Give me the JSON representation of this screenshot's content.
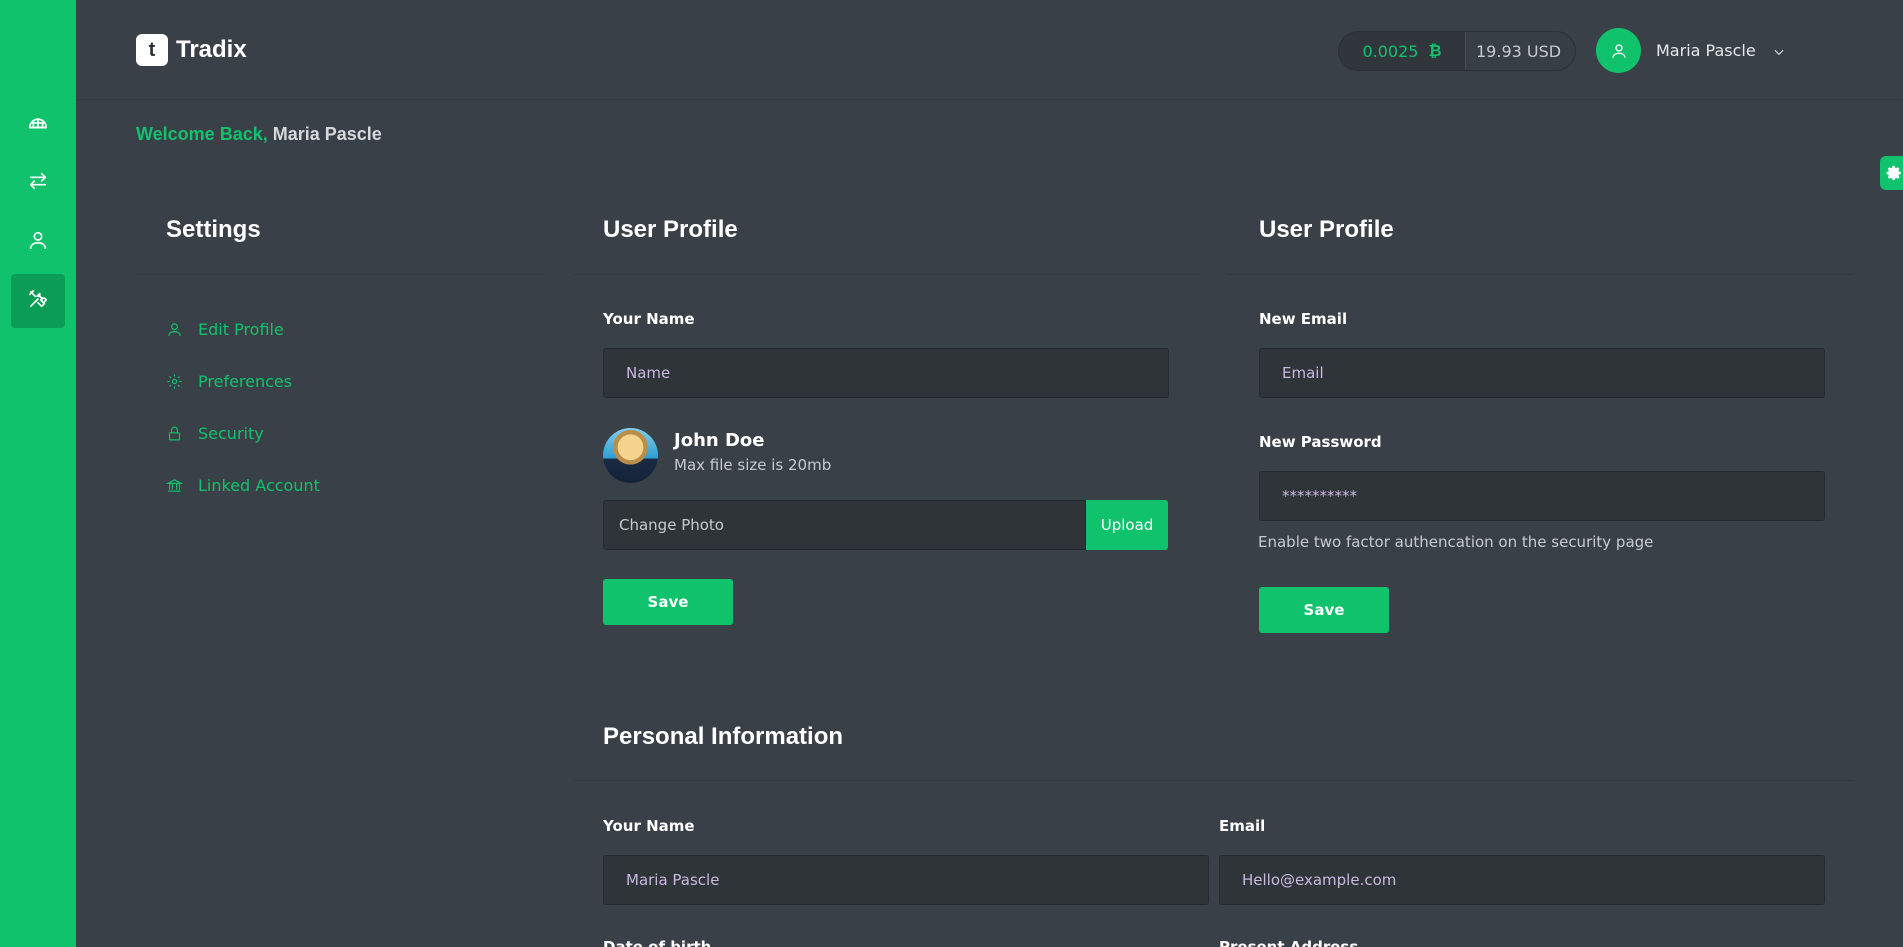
{
  "brand": {
    "name": "Tradix",
    "mark": "t"
  },
  "rail": {
    "items": [
      {
        "icon": "dashboard-icon",
        "active": false
      },
      {
        "icon": "exchange-icon",
        "active": false
      },
      {
        "icon": "user-icon",
        "active": false
      },
      {
        "icon": "tools-icon",
        "active": true
      }
    ]
  },
  "header": {
    "btc_balance": "0.0025",
    "btc_symbol": "₿",
    "usd_balance": "19.93 USD",
    "user_name": "Maria Pascle"
  },
  "welcome": {
    "prefix": "Welcome Back,",
    "name": "Maria Pascle"
  },
  "settings": {
    "title": "Settings",
    "menu": [
      {
        "label": "Edit Profile",
        "icon": "user-icon"
      },
      {
        "label": "Preferences",
        "icon": "gear-icon"
      },
      {
        "label": "Security",
        "icon": "lock-icon"
      },
      {
        "label": "Linked Account",
        "icon": "bank-icon"
      }
    ]
  },
  "profile_card": {
    "title": "User Profile",
    "name_label": "Your Name",
    "name_placeholder": "Name",
    "display_name": "John Doe",
    "file_hint": "Max file size is 20mb",
    "change_photo": "Change Photo",
    "upload_label": "Upload",
    "save_label": "Save"
  },
  "account_card": {
    "title": "User Profile",
    "email_label": "New Email",
    "email_placeholder": "Email",
    "password_label": "New Password",
    "password_placeholder": "**********",
    "hint": "Enable two factor authencation on the security page",
    "save_label": "Save"
  },
  "personal": {
    "title": "Personal Information",
    "name_label": "Your Name",
    "name_placeholder": "Maria Pascle",
    "email_label": "Email",
    "email_placeholder": "Hello@example.com",
    "dob_label": "Date of birth",
    "address_label": "Present Address"
  },
  "colors": {
    "accent": "#11c26d",
    "background": "#3a4047",
    "input": "#2f3439"
  }
}
